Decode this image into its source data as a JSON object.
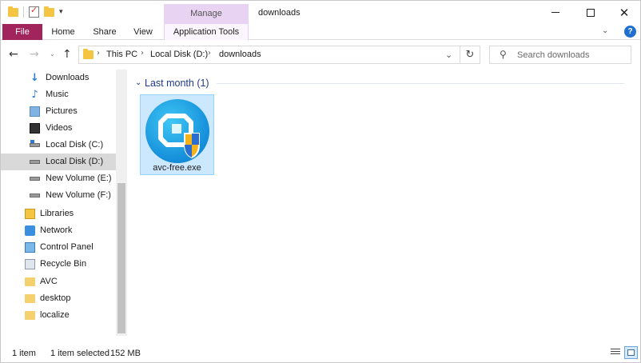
{
  "window": {
    "title": "downloads",
    "manage_label": "Manage"
  },
  "ribbon": {
    "tabs": [
      {
        "label": "File"
      },
      {
        "label": "Home"
      },
      {
        "label": "Share"
      },
      {
        "label": "View"
      },
      {
        "label": "Application Tools"
      }
    ]
  },
  "address": {
    "crumbs": [
      "This PC",
      "Local Disk (D:)",
      "downloads"
    ]
  },
  "search": {
    "placeholder": "Search downloads"
  },
  "sidebar": {
    "items": [
      {
        "label": "Downloads",
        "icon": "downloads-icon"
      },
      {
        "label": "Music",
        "icon": "music-icon"
      },
      {
        "label": "Pictures",
        "icon": "pictures-icon"
      },
      {
        "label": "Videos",
        "icon": "videos-icon"
      },
      {
        "label": "Local Disk (C:)",
        "icon": "drive-icon"
      },
      {
        "label": "Local Disk (D:)",
        "icon": "drive-icon",
        "selected": true
      },
      {
        "label": "New Volume (E:)",
        "icon": "drive-icon"
      },
      {
        "label": "New Volume (F:)",
        "icon": "drive-icon"
      },
      {
        "label": "Libraries",
        "icon": "libraries-icon"
      },
      {
        "label": "Network",
        "icon": "network-icon"
      },
      {
        "label": "Control Panel",
        "icon": "control-panel-icon"
      },
      {
        "label": "Recycle Bin",
        "icon": "recycle-bin-icon"
      },
      {
        "label": "AVC",
        "icon": "folder-icon"
      },
      {
        "label": "desktop",
        "icon": "folder-icon"
      },
      {
        "label": "localize",
        "icon": "folder-icon"
      }
    ]
  },
  "content": {
    "group_label": "Last month (1)",
    "files": [
      {
        "name": "avc-free.exe",
        "icon": "avc-installer-icon"
      }
    ]
  },
  "status": {
    "count": "1 item",
    "selected": "1 item selected",
    "size": "152 MB"
  },
  "colors": {
    "file_tab": "#a1245c",
    "manage_tab": "#e9d3f3",
    "selection": "#cce8ff",
    "group_header": "#1e3a8a"
  }
}
